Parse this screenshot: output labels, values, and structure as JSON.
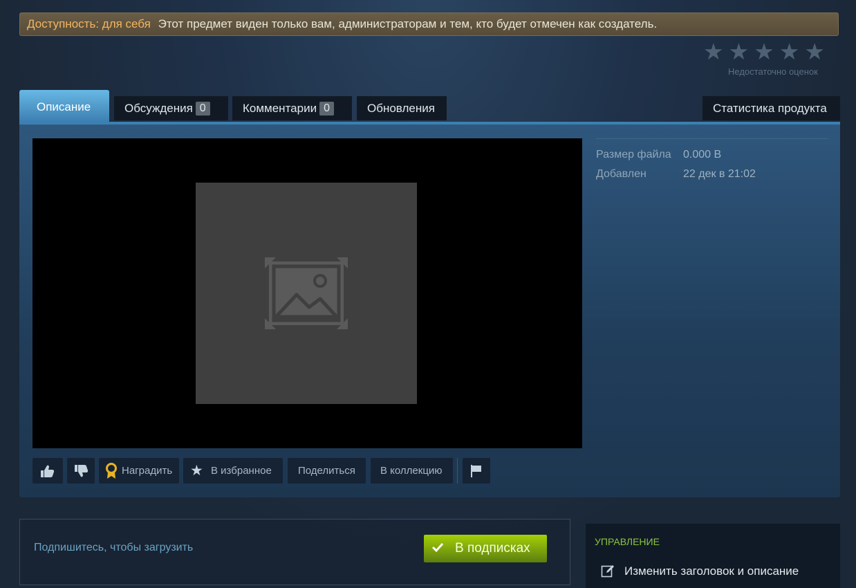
{
  "banner": {
    "label": "Доступность: для себя",
    "message": "Этот предмет виден только вам, администраторам и тем, кто будет отмечен как создатель."
  },
  "rating": {
    "stars_filled": 0,
    "stars_total": 5,
    "text": "Недостаточно оценок"
  },
  "tabs": [
    {
      "label": "Описание",
      "active": true
    },
    {
      "label": "Обсуждения",
      "count": "0"
    },
    {
      "label": "Комментарии",
      "count": "0"
    },
    {
      "label": "Обновления"
    }
  ],
  "stats_tab": {
    "label": "Статистика продукта"
  },
  "stats": [
    {
      "key": "Размер файла",
      "value": "0.000 B"
    },
    {
      "key": "Добавлен",
      "value": "22 дек в 21:02"
    }
  ],
  "actions": {
    "award": "Наградить",
    "favorite": "В избранное",
    "share": "Поделиться",
    "collection": "В коллекцию"
  },
  "subscribe": {
    "prompt": "Подпишитесь, чтобы загрузить",
    "button": "В подписках"
  },
  "manage": {
    "title": "УПРАВЛЕНИЕ",
    "edit_link": "Изменить заголовок и описание"
  },
  "colors": {
    "accent_blue": "#3b80b2",
    "subscribe_green": "#a4d007",
    "warning_label": "#f2b560",
    "manage_title": "#8bc53f"
  }
}
